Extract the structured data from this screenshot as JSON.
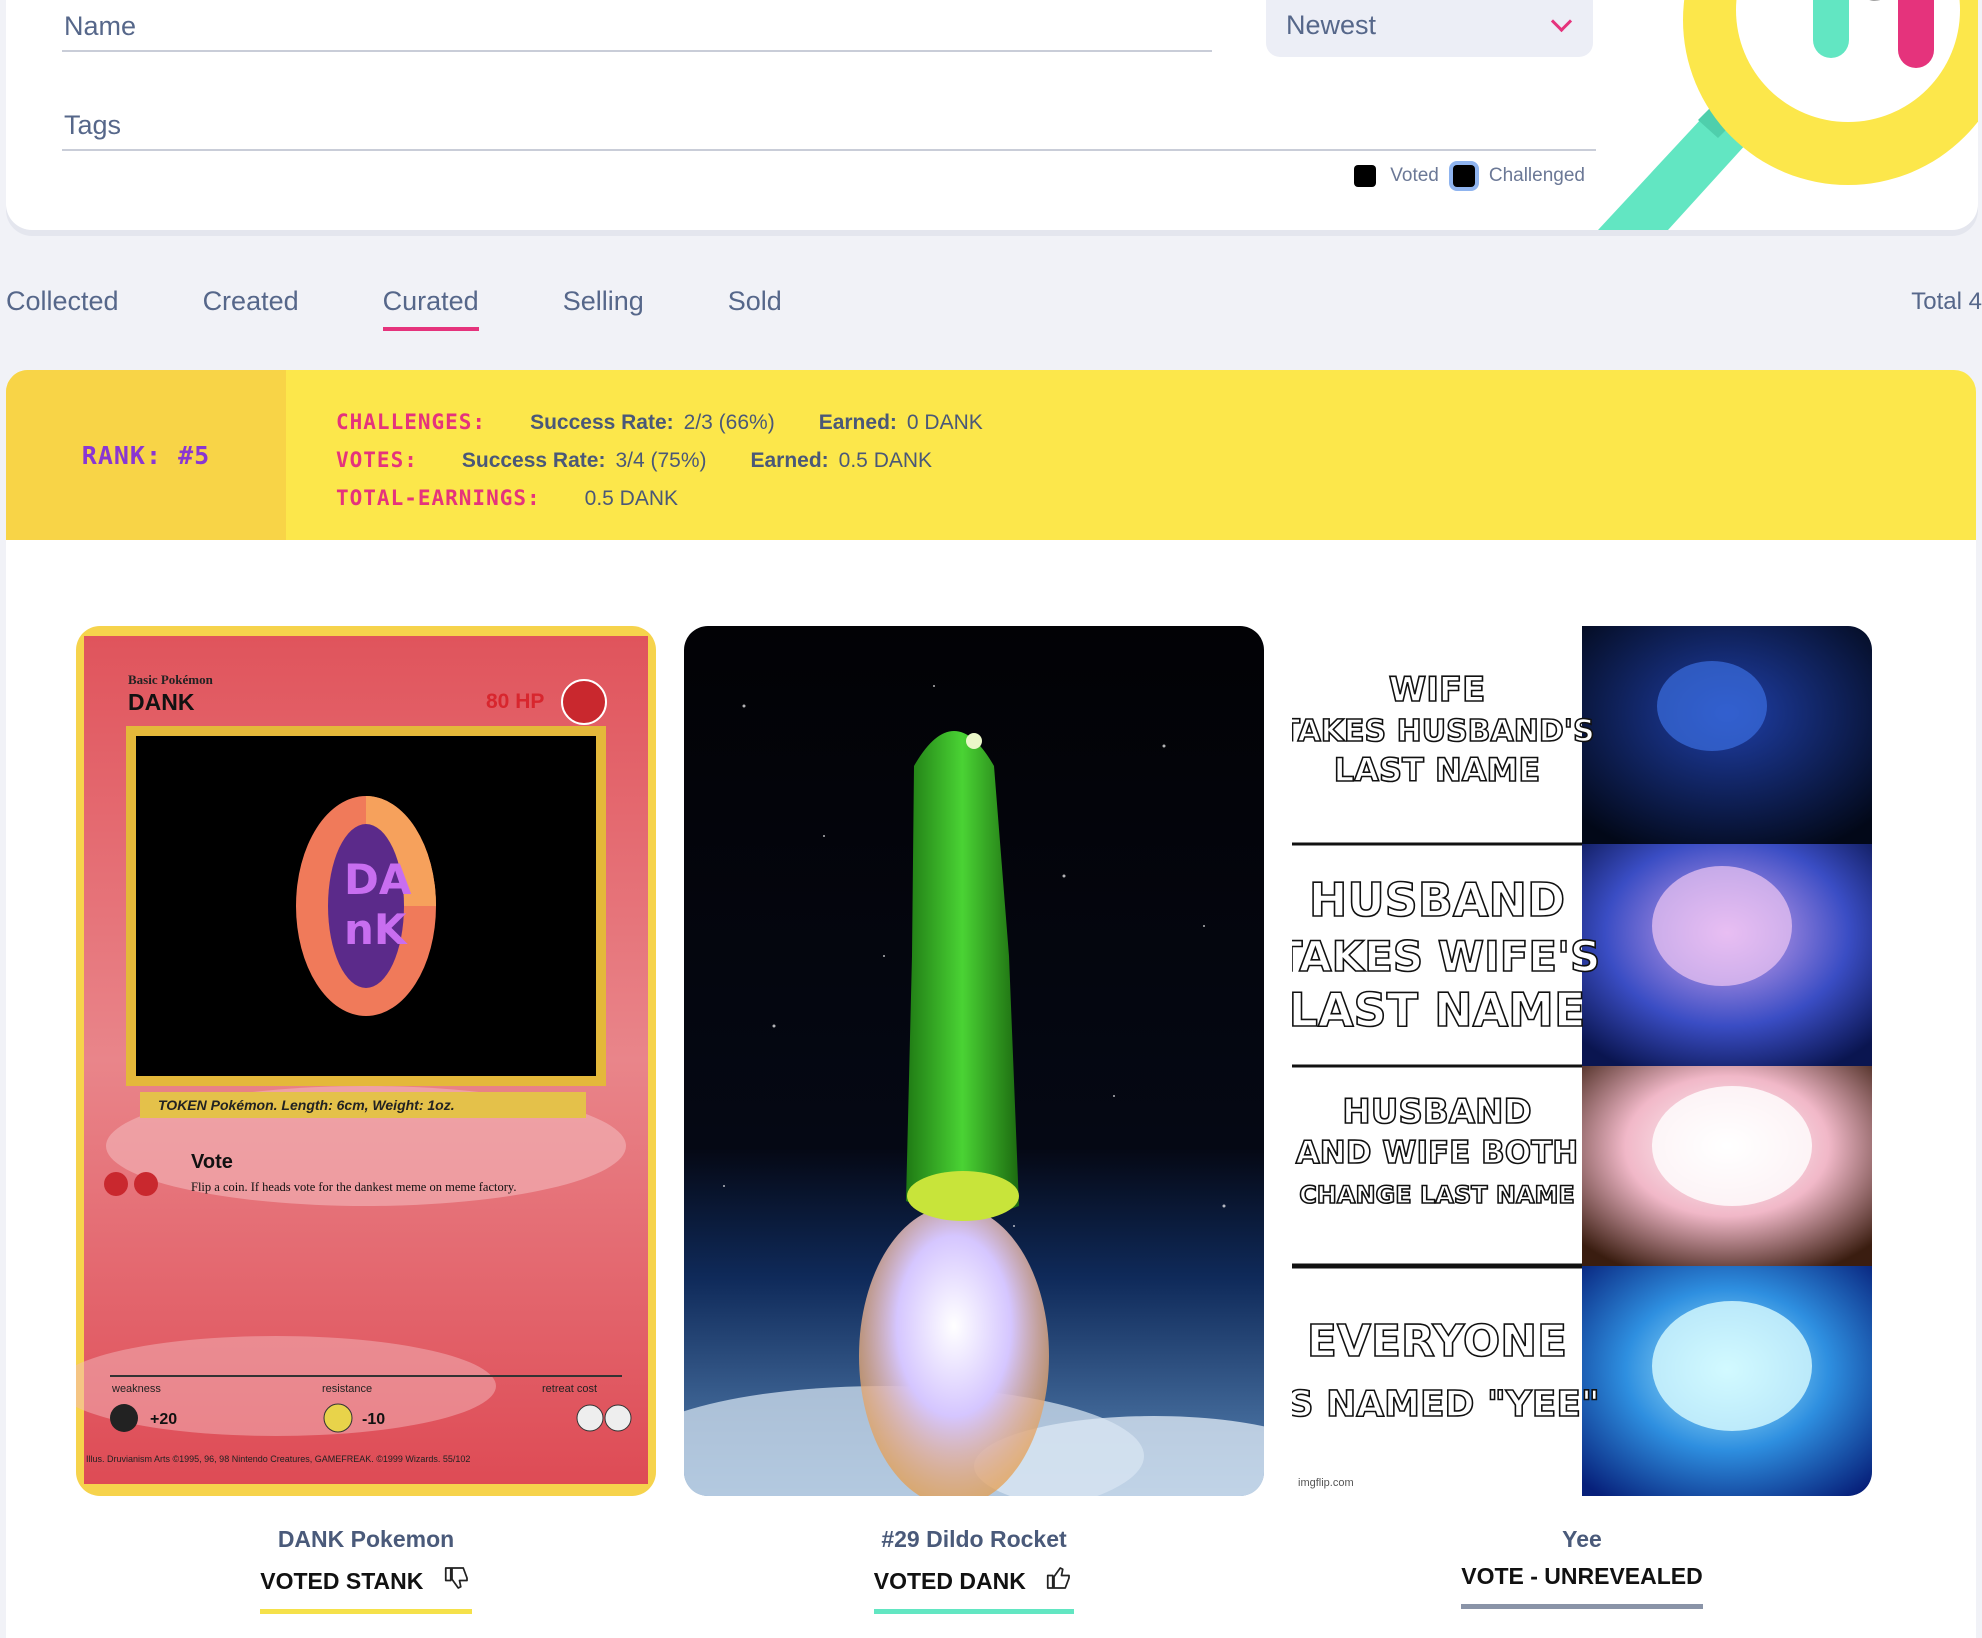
{
  "filters": {
    "name_placeholder": "Name",
    "tags_placeholder": "Tags",
    "sort_value": "Newest",
    "checkbox_voted": "Voted",
    "checkbox_challenged": "Challenged"
  },
  "tabs": [
    {
      "label": "Collected",
      "active": false
    },
    {
      "label": "Created",
      "active": false
    },
    {
      "label": "Curated",
      "active": true
    },
    {
      "label": "Selling",
      "active": false
    },
    {
      "label": "Sold",
      "active": false
    }
  ],
  "total_label": "Total 4",
  "stats": {
    "rank_label": "RANK: #5",
    "challenges": {
      "key": "CHALLENGES:",
      "success_label": "Success Rate:",
      "success_value": "2/3 (66%)",
      "earned_label": "Earned:",
      "earned_value": "0 DANK"
    },
    "votes": {
      "key": "VOTES:",
      "success_label": "Success Rate:",
      "success_value": "3/4 (75%)",
      "earned_label": "Earned:",
      "earned_value": "0.5 DANK"
    },
    "total": {
      "key": "TOTAL-EARNINGS:",
      "value": "0.5 DANK"
    }
  },
  "memes": [
    {
      "title": "DANK Pokemon",
      "status": "VOTED STANK",
      "accent": "#f5e14a",
      "icon": "thumbs-down-icon",
      "card_text": {
        "stage": "Basic Pokémon",
        "name": "DANK",
        "hp": "80 HP",
        "info": "TOKEN Pokémon. Length: 6cm, Weight: 1oz.",
        "attack_name": "Vote",
        "attack_desc": "Flip a coin. If heads vote for the dankest meme on meme factory.",
        "weakness": "weakness",
        "weakness_value": "+20",
        "resistance": "resistance",
        "resistance_value": "-10",
        "retreat": "retreat cost",
        "footer": "Illus. Druvianism Arts   ©1995, 96, 98 Nintendo Creatures, GAMEFREAK. ©1999 Wizards.  55/102",
        "logo_top": "DA",
        "logo_bottom": "nK"
      }
    },
    {
      "title": "#29 Dildo Rocket",
      "status": "VOTED DANK",
      "accent": "#62e6c2",
      "icon": "thumbs-up-icon"
    },
    {
      "title": "Yee",
      "status": "VOTE - UNREVEALED",
      "accent": "#8a94a8",
      "panels": [
        [
          "WIFE",
          "TAKES HUSBAND'S",
          "LAST NAME"
        ],
        [
          "HUSBAND",
          "TAKES WIFE'S",
          "LAST NAME"
        ],
        [
          "HUSBAND",
          "AND WIFE BOTH",
          "CHANGE LAST NAME"
        ],
        [
          "EVERYONE",
          "IS NAMED \"YEE\""
        ]
      ],
      "watermark": "imgflip.com"
    }
  ],
  "colors": {
    "accent_pink": "#e5337c",
    "banner_yellow": "#fce74b",
    "rank_purple": "#8a37d2"
  }
}
